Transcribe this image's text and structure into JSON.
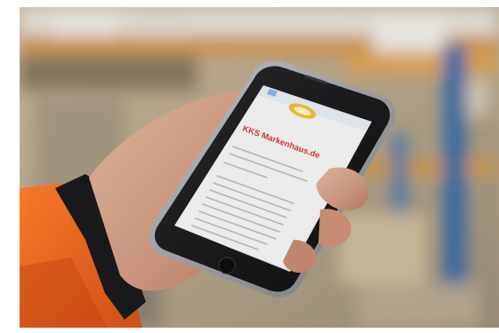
{
  "photo": {
    "description_hidden": "",
    "phone_screen": {
      "headline": "KKS Markenhaus.de",
      "app": "mobile-web-page"
    },
    "colors": {
      "background_white": "#ffffff",
      "shelf_orange": "#d59a4e",
      "shelf_blue": "#3d6ea8",
      "jacket_orange": "#ee6a1e",
      "cuff_black": "#1b1b1d",
      "skin": "#d9a98f",
      "phone_body": "#1a1a1c",
      "phone_frame": "#a9aaad",
      "screen_bg": "#f6f6f6",
      "headline_red": "#d63a3a",
      "logo_yellow": "#f0c330",
      "url_bar_blue": "#8cb7e8"
    }
  }
}
